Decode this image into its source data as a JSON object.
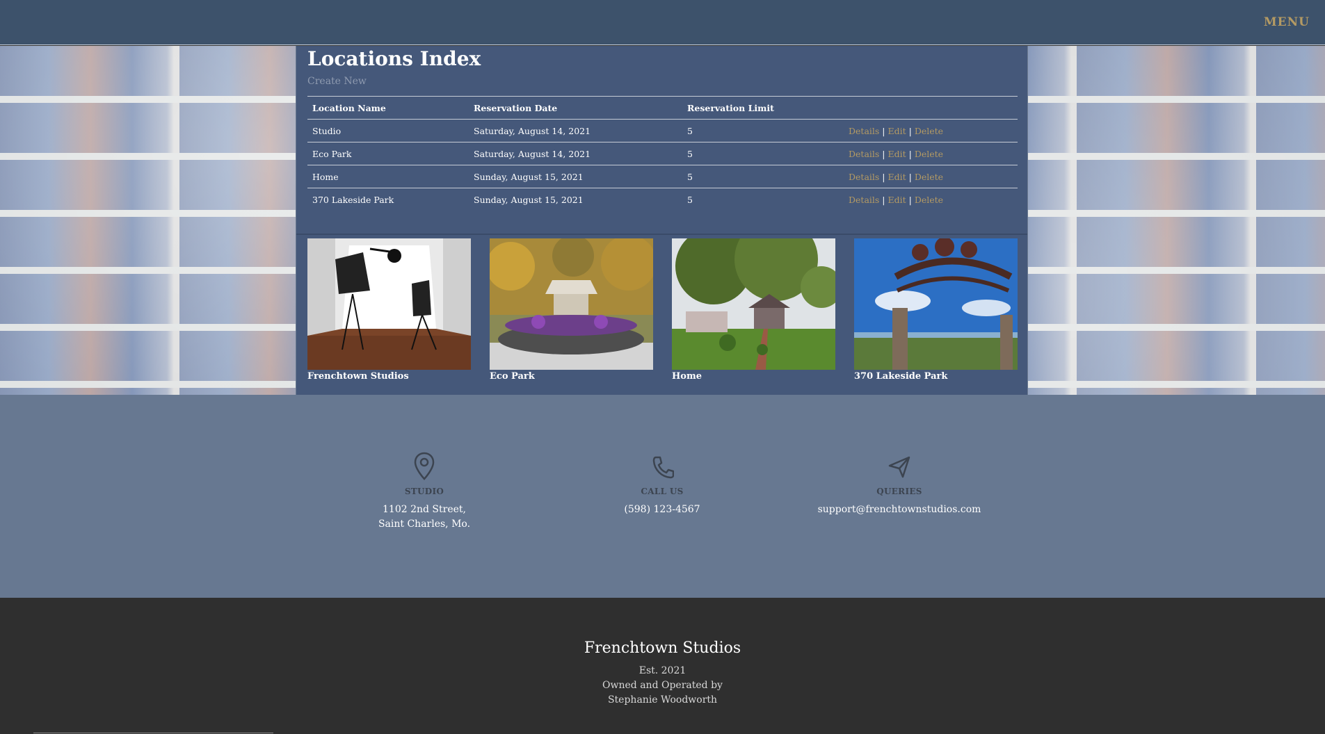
{
  "nav": {
    "menu_label": "MENU"
  },
  "page": {
    "title": "Locations Index",
    "create_new_label": "Create New"
  },
  "table": {
    "headers": [
      "Location Name",
      "Reservation Date",
      "Reservation Limit",
      ""
    ],
    "rows": [
      {
        "name": "Studio",
        "date": "Saturday, August 14, 2021",
        "limit": "5"
      },
      {
        "name": "Eco Park",
        "date": "Saturday, August 14, 2021",
        "limit": "5"
      },
      {
        "name": "Home",
        "date": "Sunday, August 15, 2021",
        "limit": "5"
      },
      {
        "name": "370 Lakeside Park",
        "date": "Sunday, August 15, 2021",
        "limit": "5"
      }
    ],
    "actions": {
      "details": "Details",
      "edit": "Edit",
      "delete": "Delete",
      "separator": "|"
    }
  },
  "gallery": [
    {
      "caption": "Frenchtown Studios",
      "icon": "photo-studio-image"
    },
    {
      "caption": "Eco Park",
      "icon": "eco-park-image"
    },
    {
      "caption": "Home",
      "icon": "home-gazebo-image"
    },
    {
      "caption": "370 Lakeside Park",
      "icon": "lakeside-park-sign-image"
    }
  ],
  "contact": {
    "studio": {
      "heading": "STUDIO",
      "text": "1102 2nd Street, Saint Charles, Mo.",
      "icon": "map-pin-icon"
    },
    "call": {
      "heading": "CALL US",
      "text": "(598) 123-4567",
      "icon": "phone-icon"
    },
    "queries": {
      "heading": "QUERIES",
      "text": "support@frenchtownstudios.com",
      "icon": "paper-plane-icon"
    }
  },
  "footer": {
    "name": "Frenchtown Studios",
    "est": "Est. 2021",
    "owned_line1": "Owned and Operated by",
    "owned_line2": "Stephanie Woodworth"
  },
  "colors": {
    "navbar": "#3d526b",
    "panel": "#45587a",
    "accent_link": "#b49a63",
    "contact_strip": "#677891",
    "footer": "#2f2f2f"
  }
}
